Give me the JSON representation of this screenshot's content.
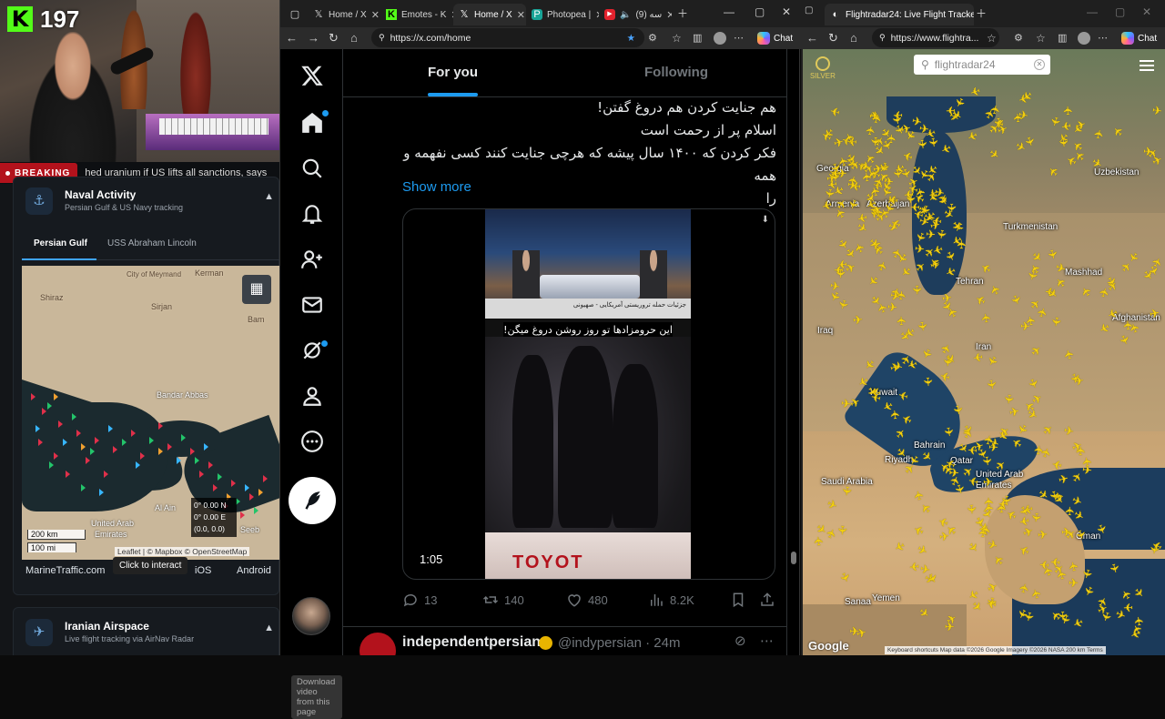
{
  "stream": {
    "kick_count": "197",
    "breaking_label": "BREAKING",
    "ticker": "hed uranium if US lifts all sanctions, says",
    "naval": {
      "title": "Naval Activity",
      "subtitle": "Persian Gulf & US Navy tracking"
    },
    "tabs": [
      "Persian Gulf",
      "USS Abraham Lincoln"
    ],
    "map_labels": {
      "shiraz": "Shiraz",
      "kerman": "Kerman",
      "sirjan": "Sirjan",
      "bam": "Bam",
      "meymand": "City of Meymand",
      "bandar": "Bandar Abbas",
      "alain": "Al Ain",
      "uae1": "United Arab",
      "uae2": "Emirates",
      "seeb": "Seeb"
    },
    "coords": [
      "0° 0.00 N",
      "0° 0.00 E",
      "(0.0, 0.0)"
    ],
    "scale_km": "200 km",
    "scale_mi": "100 mi",
    "attribution": "Leaflet | © Mapbox © OpenStreetMap",
    "footer": {
      "marine": "MarineTraffic.com",
      "ios": "iOS",
      "android": "Android"
    },
    "tooltip": "Click to interact",
    "airspace": {
      "title": "Iranian Airspace",
      "subtitle": "Live flight tracking via AirNav Radar"
    }
  },
  "xbrowser": {
    "tabs": [
      {
        "label": "Home / X",
        "fav": "𝕏"
      },
      {
        "label": "Emotes - K",
        "fav": "K"
      },
      {
        "label": "Home / X",
        "fav": "𝕏"
      },
      {
        "label": "Photopea |",
        "fav": "P"
      },
      {
        "label": "(9) سه",
        "fav": "▶"
      }
    ],
    "url": "https://x.com/home",
    "chat": "Chat"
  },
  "x": {
    "tabs": {
      "for_you": "For you",
      "following": "Following"
    },
    "tweet_lines": [
      "هم جنایت کردن هم دروغ گفتن!",
      "اسلام پر از رحمت است",
      "فکر کردن که ۱۴۰۰ سال پیشه که هرچی جنایت کنند کسی نفهمه و همه",
      "را"
    ],
    "show_more": "Show more",
    "video_caption": "این حرومزادها تو روز روشن دروغ میگن!",
    "band_text": "جزئیات حمله تروریستی آمریکایی - صهیونی",
    "truck_text": "TOYOT",
    "duration": "1:05",
    "replies": "13",
    "reposts": "140",
    "likes": "480",
    "views": "8.2K",
    "next_name": "independentpersian",
    "next_handle": "@indypersian · 24m",
    "download_bar": "Download video from this page"
  },
  "frbrowser": {
    "tab": "Flightradar24: Live Flight Tracker",
    "url": "https://www.flightra...",
    "chat": "Chat",
    "search_placeholder": "flightradar24",
    "badge": "SILVER",
    "labels": {
      "georgia": "Georgia",
      "armenia": "Armenia",
      "azerbaijan": "Azerbaijan",
      "uzbekistan": "Uzbekistan",
      "turkmenistan": "Turkmenistan",
      "tehran": "Tehran",
      "iran": "Iran",
      "iraq": "Iraq",
      "kuwait": "Kuwait",
      "bahrain": "Bahrain",
      "qatar": "Qatar",
      "uae": "United Arab Emirates",
      "saudi": "Saudi Arabia",
      "oman": "Oman",
      "yemen": "Yemen",
      "sanaa": "Sanaa",
      "afghanistan": "Afghanistan",
      "mashhad": "Mashhad",
      "riyadh": "Riyadh"
    },
    "google": "Google",
    "footer": "Keyboard shortcuts   Map data ©2026 Google Imagery ©2026 NASA   200 km   Terms"
  }
}
